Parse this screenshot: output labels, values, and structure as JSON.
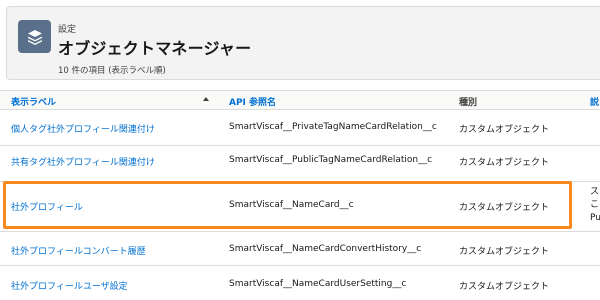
{
  "header": {
    "breadcrumb": "設定",
    "title": "オブジェクトマネージャー",
    "item_count": "10 件の項目 (表示ラベル順)",
    "app_icon": "layers-icon"
  },
  "columns": {
    "label": "表示ラベル",
    "api_name": "API 参照名",
    "type": "種別",
    "description": "説"
  },
  "rows": [
    {
      "label": "個人タグ社外プロフィール関連付け",
      "api_name": "SmartViscaf__PrivateTagNameCardRelation__c",
      "type": "カスタムオブジェクト",
      "desc": ""
    },
    {
      "label": "共有タグ社外プロフィール関連付け",
      "api_name": "SmartViscaf__PublicTagNameCardRelation__c",
      "type": "カスタムオブジェクト",
      "desc": ""
    },
    {
      "label": "社外プロフィール",
      "api_name": "SmartViscaf__NameCard__c",
      "type": "カスタムオブジェクト",
      "desc": "ス\nこ\nPu"
    },
    {
      "label": "社外プロフィールコンバート履歴",
      "api_name": "SmartViscaf__NameCardConvertHistory__c",
      "type": "カスタムオブジェクト",
      "desc": ""
    },
    {
      "label": "社外プロフィールユーザ設定",
      "api_name": "SmartViscaf__NameCardUserSetting__c",
      "type": "カスタムオブジェクト",
      "desc": ""
    }
  ],
  "colors": {
    "link": "#0070d2",
    "highlight": "#f7891f",
    "icon_bg": "#5a6f8a"
  }
}
